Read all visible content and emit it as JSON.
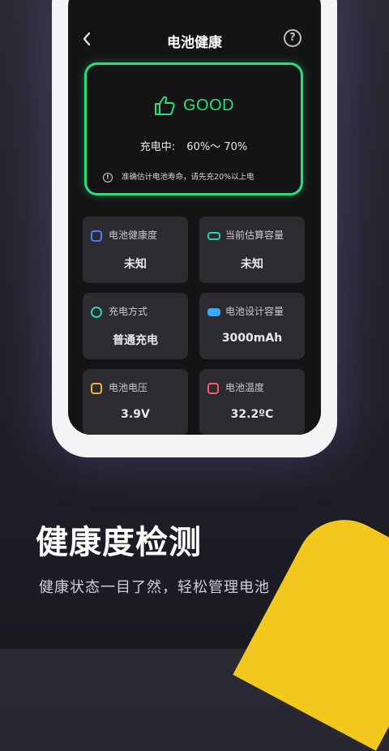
{
  "nav": {
    "title": "电池健康"
  },
  "status": {
    "label": "GOOD",
    "color": "#25e07c"
  },
  "charging": {
    "label": "充电中:",
    "range": "60%～ 70%"
  },
  "note": "准确估计电池寿命，请先充20%以上电",
  "tiles": [
    {
      "label": "电池健康度",
      "value": "未知",
      "icon": "battery-health-icon",
      "icon_color": "#4a7cff"
    },
    {
      "label": "当前估算容量",
      "value": "未知",
      "icon": "battery-capacity-icon",
      "icon_color": "#2bd3b6"
    },
    {
      "label": "充电方式",
      "value": "普通充电",
      "icon": "charging-mode-icon",
      "icon_color": "#2bd3b6"
    },
    {
      "label": "电池设计容量",
      "value": "3000mAh",
      "icon": "battery-design-icon",
      "icon_color": "#3aa8ff"
    },
    {
      "label": "电池电压",
      "value": "3.9V",
      "icon": "voltage-icon",
      "icon_color": "#f2b136"
    },
    {
      "label": "电池温度",
      "value": "32.2ºC",
      "icon": "temperature-icon",
      "icon_color": "#ff5a6a"
    }
  ],
  "promo": {
    "headline": "健康度检测",
    "subline": "健康状态一目了然，轻松管理电池"
  }
}
